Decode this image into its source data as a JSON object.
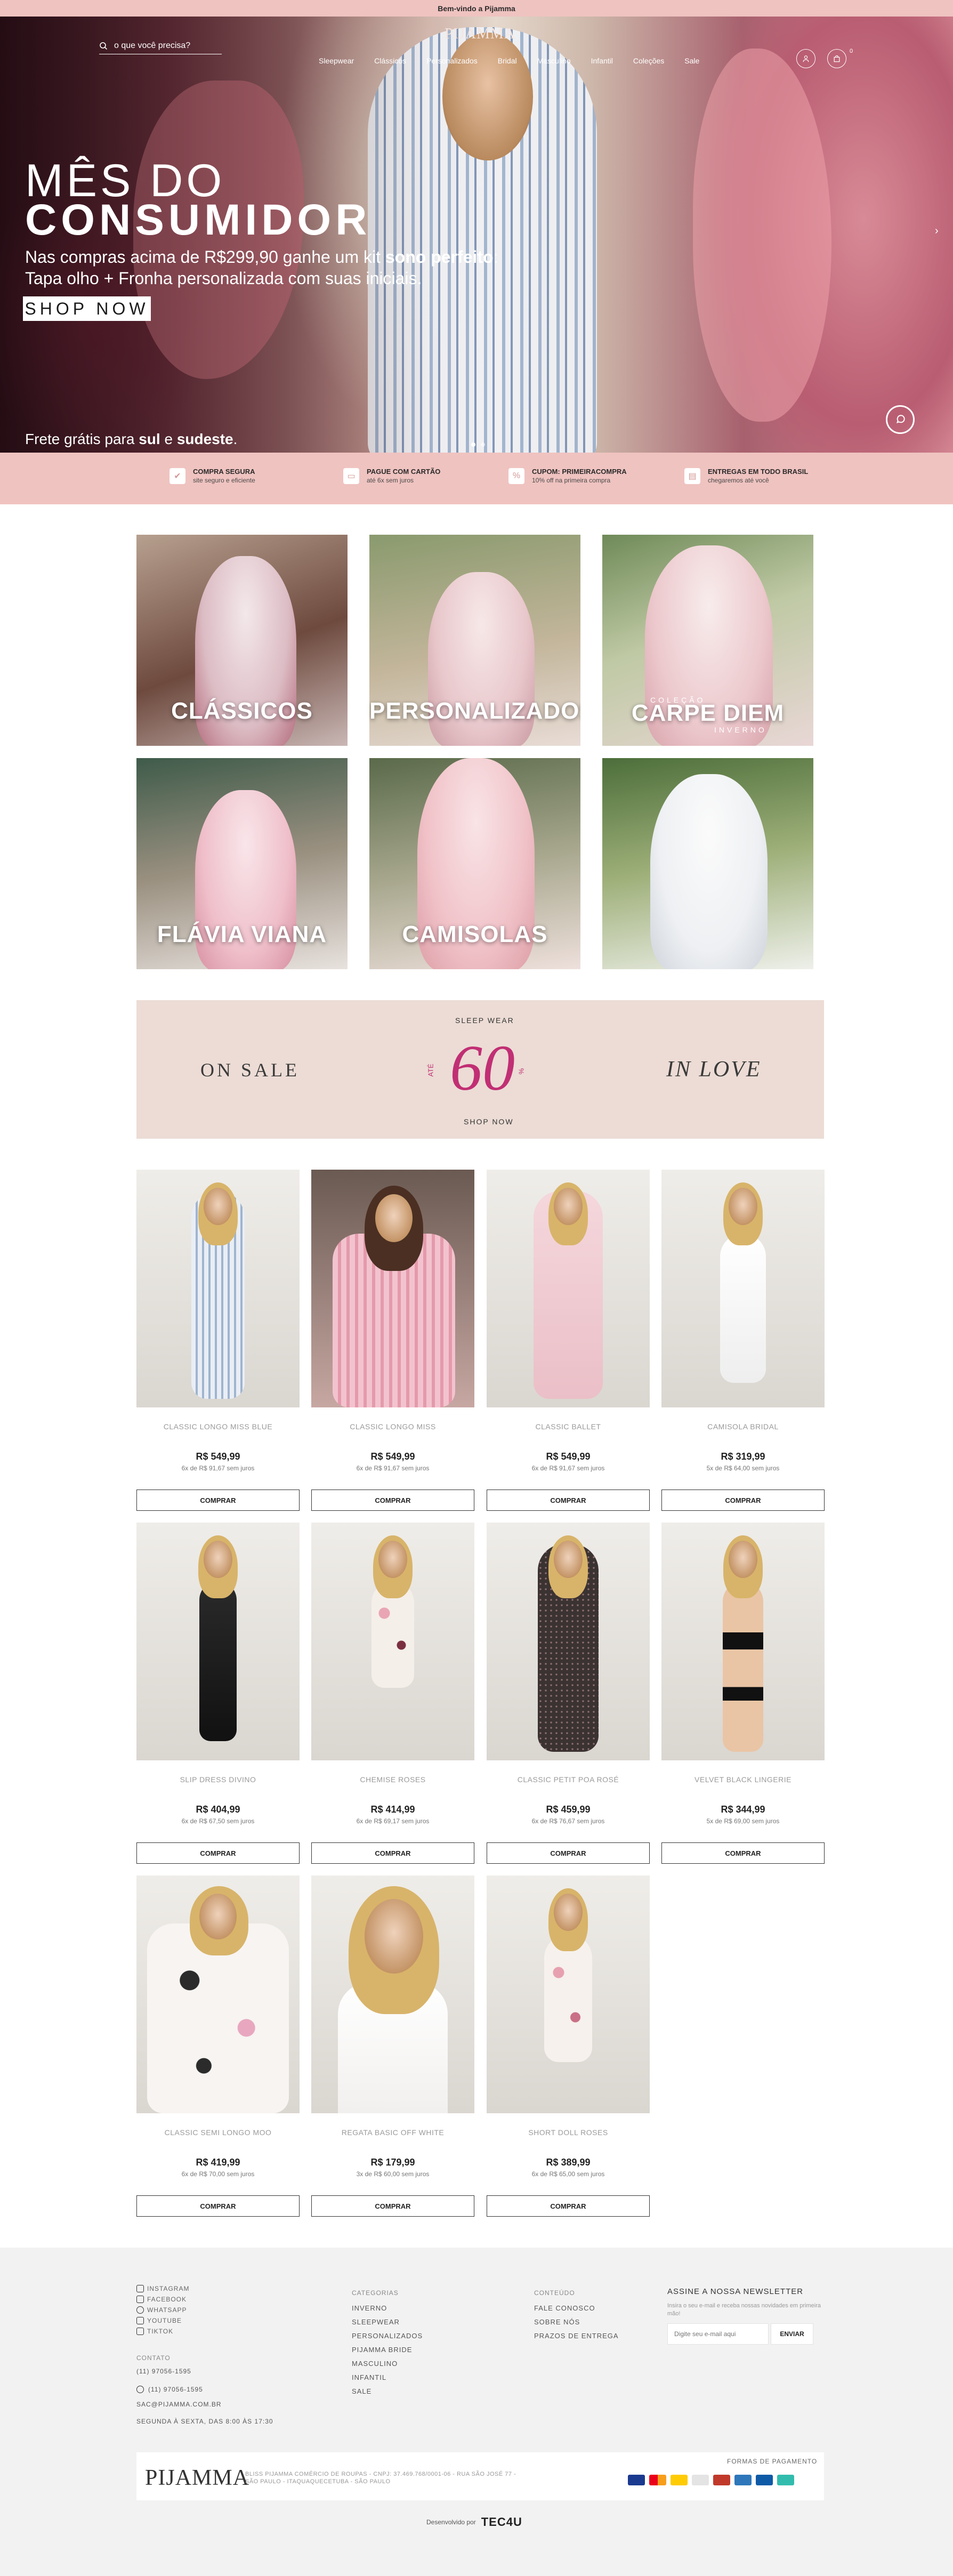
{
  "topbar": {
    "text": "Bem-vindo a Pijamma"
  },
  "header": {
    "search_placeholder": "o que você precisa?",
    "logo": "PIJAMMA",
    "menu": [
      "Sleepwear",
      "Clássicos",
      "Personalizados",
      "Bridal",
      "Masculino",
      "Infantil",
      "Coleções",
      "Sale"
    ],
    "cart_count": "0"
  },
  "hero": {
    "title_line1": "MÊS DO",
    "title_line2": "CONSUMIDOR",
    "text_a": "Nas compras acima de R$299,90 ganhe um kit ",
    "text_b": "sono perfeito",
    "text_c": ":",
    "text_d": "Tapa olho + Fronha personalizada com suas iniciais.",
    "button": "SHOP NOW",
    "free_a": "Frete grátis para ",
    "free_b": "sul",
    "free_c": " e ",
    "free_d": "sudeste",
    "free_e": "."
  },
  "benefits": [
    {
      "title": "COMPRA SEGURA",
      "sub": "site seguro e eficiente"
    },
    {
      "title": "PAGUE COM CARTÃO",
      "sub": "até 6x sem juros"
    },
    {
      "title": "CUPOM: PRIMEIRACOMPRA",
      "sub": "10% off na primeira compra"
    },
    {
      "title": "ENTREGAS EM TODO BRASIL",
      "sub": "chegaremos até você"
    }
  ],
  "categories": [
    {
      "label": "CLÁSSICOS"
    },
    {
      "label": "PERSONALIZADOS"
    },
    {
      "label": "CARPE DIEM",
      "pre": "COLEÇÃO",
      "post": "INVERNO"
    },
    {
      "label": "FLÁVIA VIANA"
    },
    {
      "label": "CAMISOLAS"
    },
    {
      "label": ""
    }
  ],
  "sale_banner": {
    "left": "ON SALE",
    "kicker": "SLEEP WEAR",
    "ate": "ATÉ",
    "number": "60",
    "pct": "%",
    "cta": "SHOP NOW",
    "right": "IN LOVE"
  },
  "products": [
    {
      "name": "CLASSIC LONGO MISS BLUE",
      "price": "R$ 549,99",
      "installments": "6x de R$ 91,67 sem juros",
      "buy": "COMPRAR"
    },
    {
      "name": "CLASSIC LONGO MISS",
      "price": "R$ 549,99",
      "installments": "6x de R$ 91,67 sem juros",
      "buy": "COMPRAR"
    },
    {
      "name": "CLASSIC BALLET",
      "price": "R$ 549,99",
      "installments": "6x de R$ 91,67 sem juros",
      "buy": "COMPRAR"
    },
    {
      "name": "CAMISOLA BRIDAL",
      "price": "R$ 319,99",
      "installments": "5x de R$ 64,00 sem juros",
      "buy": "COMPRAR"
    },
    {
      "name": "SLIP DRESS DIVINO",
      "price": "R$ 404,99",
      "installments": "6x de R$ 67,50 sem juros",
      "buy": "COMPRAR"
    },
    {
      "name": "CHEMISE ROSES",
      "price": "R$ 414,99",
      "installments": "6x de R$ 69,17 sem juros",
      "buy": "COMPRAR"
    },
    {
      "name": "CLASSIC PETIT POA ROSÉ",
      "price": "R$ 459,99",
      "installments": "6x de R$ 76,67 sem juros",
      "buy": "COMPRAR"
    },
    {
      "name": "VELVET BLACK LINGERIE",
      "price": "R$ 344,99",
      "installments": "5x de R$ 69,00 sem juros",
      "buy": "COMPRAR"
    },
    {
      "name": "CLASSIC SEMI LONGO MOO",
      "price": "R$ 419,99",
      "installments": "6x de R$ 70,00 sem juros",
      "buy": "COMPRAR"
    },
    {
      "name": "REGATA BASIC OFF WHITE",
      "price": "R$ 179,99",
      "installments": "3x de R$ 60,00 sem juros",
      "buy": "COMPRAR"
    },
    {
      "name": "SHORT DOLL ROSES",
      "price": "R$ 389,99",
      "installments": "6x de R$ 65,00 sem juros",
      "buy": "COMPRAR"
    }
  ],
  "footer": {
    "social": [
      "INSTAGRAM",
      "FACEBOOK",
      "WHATSAPP",
      "YOUTUBE",
      "TIKTOK"
    ],
    "contact_head": "CONTATO",
    "contact_phone": "(11) 97056-1595",
    "whatsapp": "(11) 97056-1595",
    "email": "SAC@PIJAMMA.COM.BR",
    "hours": "SEGUNDA À SEXTA, DAS 8:00 ÀS 17:30",
    "categories_head": "CATEGORIAS",
    "categories": [
      "INVERNO",
      "SLEEPWEAR",
      "PERSONALIZADOS",
      "PIJAMMA BRIDE",
      "MASCULINO",
      "INFANTIL",
      "SALE"
    ],
    "content_head": "CONTEÚDO",
    "content": [
      "FALE CONOSCO",
      "SOBRE NÓS",
      "PRAZOS DE ENTREGA"
    ],
    "newsletter_title": "ASSINE A NOSSA NEWSLETTER",
    "newsletter_sub": "Insira o seu e-mail e receba nossas novidades em primeira mão!",
    "newsletter_placeholder": "Digite seu e-mail aqui",
    "newsletter_button": "ENVIAR",
    "logo": "PIJAMMA",
    "address": "BLISS PIJAMMA COMÉRCIO DE ROUPAS - CNPJ: 37.469.768/0001-06 - RUA SÃO JOSÉ 77 - SÃO PAULO - ITAQUAQUECETUBA - SÃO PAULO",
    "payment_label": "FORMAS DE PAGAMENTO",
    "developed_by": "Desenvolvido por",
    "developer": "TEC4U"
  },
  "colors": {
    "accent_pink": "#efc3c0",
    "sale_bg": "#ecdcd5",
    "sale_magenta": "#c12f74"
  }
}
